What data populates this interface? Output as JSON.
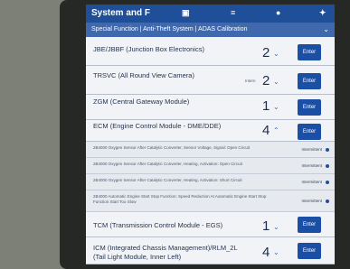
{
  "title": "System and F",
  "tabs": "Special Function | Anti-Theft System | ADAS Calibration",
  "modules": [
    {
      "label": "JBE/JBBF (Junction Box Electronics)",
      "count": "2",
      "enter": "Enter"
    },
    {
      "label": "TRSVC (All Round View Camera)",
      "count": "2",
      "enter": "Enter",
      "badge": "Intern"
    },
    {
      "label": "ZGM (Central Gateway Module)",
      "count": "1",
      "enter": "Enter"
    },
    {
      "label": "ECM (Engine Control Module - DME/DDE)",
      "count": "4",
      "enter": "Enter"
    }
  ],
  "subitems": [
    {
      "text": "2B4000 Oxygen Sensor After Catalytic Converter, Sensor Voltage, Signal: Open Circuit",
      "status": "Intermittent"
    },
    {
      "text": "2B4000 Oxygen Sensor After Catalytic Converter, Heating, Activation: Open Circuit",
      "status": "Intermittent"
    },
    {
      "text": "2B4000 Oxygen Sensor After Catalytic Converter, Heating, Activation: Short Circuit",
      "status": "Intermittent"
    },
    {
      "text": "2B4000 Automatic Engine Start Stop Function: Speed Reduction At Automatic Engine Start Stop Function Start Too Slow",
      "status": "Intermittent"
    }
  ],
  "modules2": [
    {
      "label": "TCM (Transmission Control Module - EGS)",
      "count": "1",
      "enter": "Enter"
    },
    {
      "label": "ICM (Integrated Chassis Management)/RLM_2L",
      "label2": "(Tail Light Module, Inner Left)",
      "count": "4",
      "enter": "Enter"
    }
  ],
  "colors": {
    "accent": "#1b4fa6",
    "titlebar": "#1f4f98"
  }
}
